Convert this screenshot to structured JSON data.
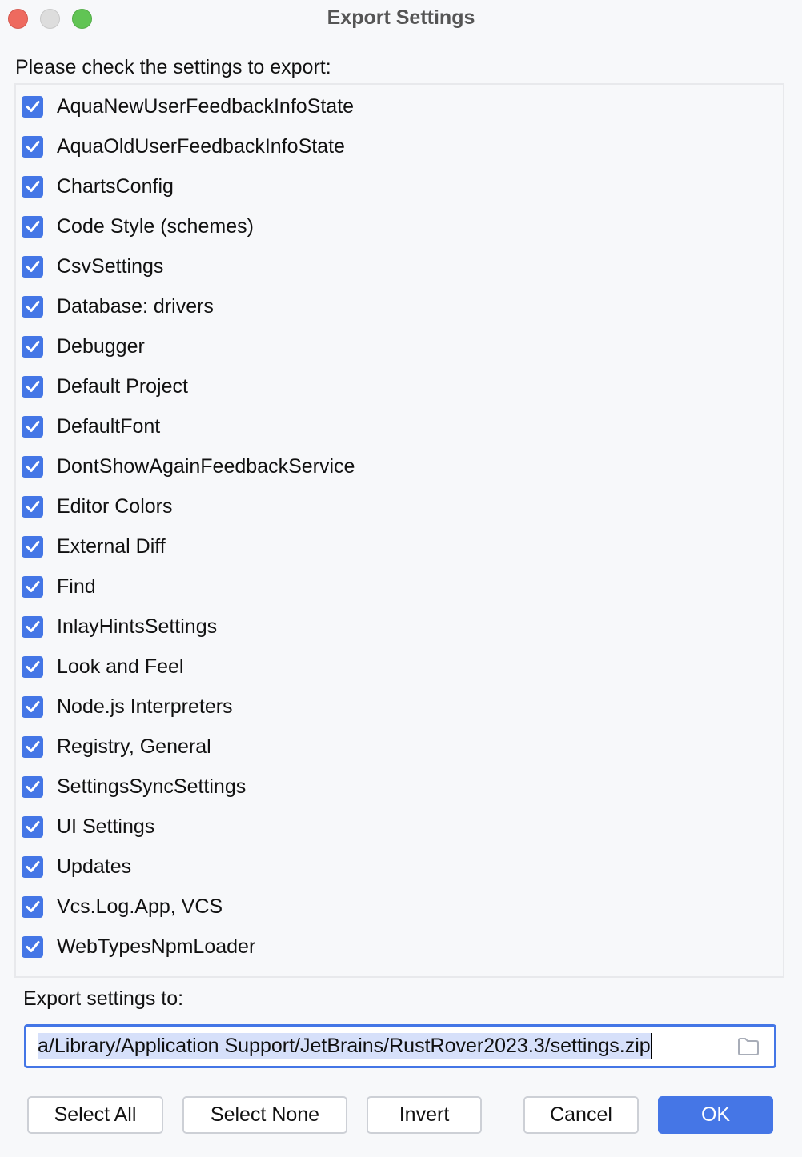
{
  "window": {
    "title": "Export Settings"
  },
  "prompt": "Please check the settings to export:",
  "settings": [
    {
      "label": "AquaNewUserFeedbackInfoState",
      "checked": true
    },
    {
      "label": "AquaOldUserFeedbackInfoState",
      "checked": true
    },
    {
      "label": "ChartsConfig",
      "checked": true
    },
    {
      "label": "Code Style (schemes)",
      "checked": true
    },
    {
      "label": "CsvSettings",
      "checked": true
    },
    {
      "label": "Database: drivers",
      "checked": true
    },
    {
      "label": "Debugger",
      "checked": true
    },
    {
      "label": "Default Project",
      "checked": true
    },
    {
      "label": "DefaultFont",
      "checked": true
    },
    {
      "label": "DontShowAgainFeedbackService",
      "checked": true
    },
    {
      "label": "Editor Colors",
      "checked": true
    },
    {
      "label": "External Diff",
      "checked": true
    },
    {
      "label": "Find",
      "checked": true
    },
    {
      "label": "InlayHintsSettings",
      "checked": true
    },
    {
      "label": "Look and Feel",
      "checked": true
    },
    {
      "label": "Node.js Interpreters",
      "checked": true
    },
    {
      "label": "Registry, General",
      "checked": true
    },
    {
      "label": "SettingsSyncSettings",
      "checked": true
    },
    {
      "label": "UI Settings",
      "checked": true
    },
    {
      "label": "Updates",
      "checked": true
    },
    {
      "label": "Vcs.Log.App, VCS",
      "checked": true
    },
    {
      "label": "WebTypesNpmLoader",
      "checked": true
    }
  ],
  "export": {
    "label": "Export settings to:",
    "path_value": "a/Library/Application Support/JetBrains/RustRover2023.3/settings.zip",
    "browse_icon": "folder-icon"
  },
  "buttons": {
    "select_all": "Select All",
    "select_none": "Select None",
    "invert": "Invert",
    "cancel": "Cancel",
    "ok": "OK"
  },
  "colors": {
    "accent": "#4476e6",
    "selection": "#d6e0fa",
    "background": "#f7f8fa"
  }
}
